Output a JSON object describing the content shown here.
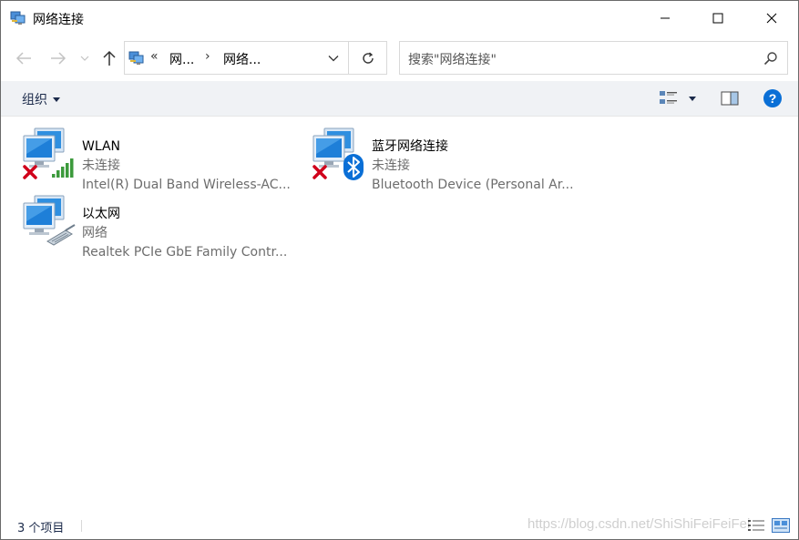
{
  "window": {
    "title": "网络连接",
    "icon": "network-connections-icon"
  },
  "titlebar_buttons": {
    "minimize": "minimize-icon",
    "maximize": "maximize-icon",
    "close": "close-icon"
  },
  "nav": {
    "back_icon": "arrow-left-icon",
    "forward_icon": "arrow-right-icon",
    "recent_icon": "chevron-down-icon",
    "up_icon": "arrow-up-icon",
    "address": {
      "overflow": "«",
      "crumbs": [
        "网...",
        "网络..."
      ],
      "separator": "›"
    },
    "search": {
      "placeholder": "搜索\"网络连接\""
    }
  },
  "command_bar": {
    "organize_label": "组织",
    "help_label": "?"
  },
  "connections": [
    {
      "name": "WLAN",
      "status": "未连接",
      "device": "Intel(R) Dual Band Wireless-AC...",
      "icon": "wifi-adapter-icon",
      "disconnected": true
    },
    {
      "name": "蓝牙网络连接",
      "status": "未连接",
      "device": "Bluetooth Device (Personal Ar...",
      "icon": "bluetooth-adapter-icon",
      "disconnected": true
    },
    {
      "name": "以太网",
      "status": "网络",
      "device": "Realtek PCIe GbE Family Contr...",
      "icon": "ethernet-adapter-icon",
      "disconnected": false
    }
  ],
  "status_bar": {
    "item_count": "3 个项目",
    "watermark": "https://blog.csdn.net/ShiShiFeiFeiFei"
  },
  "colors": {
    "accent": "#0078d7",
    "command_bar_bg": "#f0f2f5",
    "disconnect_red": "#d0021b",
    "signal_green": "#3c9a3c",
    "bluetooth_blue": "#0a6fd6"
  }
}
